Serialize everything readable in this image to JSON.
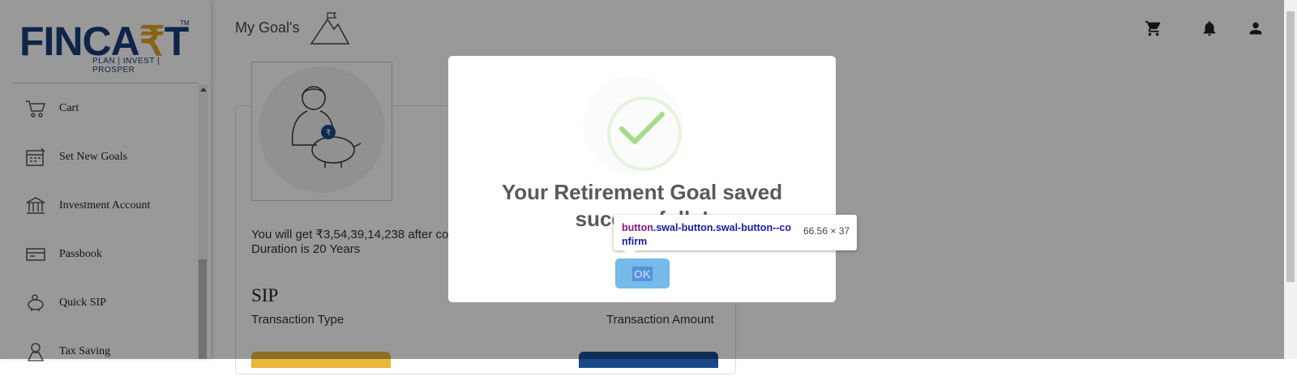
{
  "brand": {
    "logo_main": "FINCA",
    "logo_accent": "₹",
    "logo_end": "T",
    "logo_tm": "TM",
    "tagline": "PLAN | INVEST | PROSPER"
  },
  "sidebar": {
    "items": [
      {
        "label": "Cart",
        "icon": "cart-icon"
      },
      {
        "label": "Set New Goals",
        "icon": "calendar-goal-icon"
      },
      {
        "label": "Investment Account",
        "icon": "bank-icon"
      },
      {
        "label": "Passbook",
        "icon": "passbook-icon"
      },
      {
        "label": "Quick SIP",
        "icon": "piggy-bank-icon"
      },
      {
        "label": "Tax Saving",
        "icon": "tax-saving-icon"
      }
    ]
  },
  "header": {
    "title": "My Goal's",
    "icons": [
      "cart-icon",
      "bell-icon",
      "account-icon"
    ]
  },
  "goal": {
    "summary": "You will get ₹3,54,39,14,238 after co",
    "duration": "Duration is 20 Years",
    "type_value": "SIP",
    "type_label": "Transaction Type",
    "amount_label": "Transaction Amount"
  },
  "modal": {
    "title_line1": "Your Retirement Goal saved",
    "title_line2": "successfully!",
    "ok_label": "OK"
  },
  "devtools_tooltip": {
    "tag": "button",
    "classes": ".swal-button.swal-button--confirm",
    "dimensions": "66.56 × 37"
  },
  "colors": {
    "brand_blue": "#1a3c7a",
    "brand_gold": "#e8a228",
    "success_green": "#a5dc86",
    "ok_button": "#7cd1f9"
  }
}
